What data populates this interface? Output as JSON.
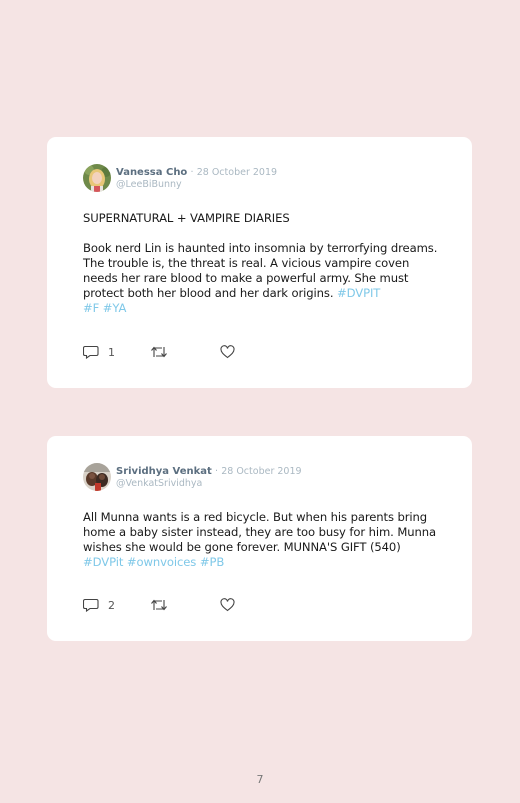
{
  "tweets": [
    {
      "author_name": "Vanessa Cho",
      "separator": "·",
      "date": "28 October 2019",
      "handle": "@LeeBiBunny",
      "title_line": "SUPERNATURAL + VAMPIRE DIARIES",
      "body": "Book nerd Lin is haunted into insomnia by terrorfying dreams. The trouble is, the threat is real. A vicious vampire coven needs her rare blood to make a powerful army. She must protect both her blood and her dark origins.",
      "hashtags": [
        "#DVPIT",
        "#F",
        "#YA"
      ],
      "reply_count": "1",
      "avatar_icon": "user-avatar-blonde",
      "icons": {
        "reply": "reply-icon",
        "retweet": "retweet-icon",
        "like": "heart-icon"
      }
    },
    {
      "author_name": "Srividhya Venkat",
      "separator": "·",
      "date": "28 October 2019",
      "handle": "@VenkatSrividhya",
      "body": "All Munna wants is a red bicycle. But when his parents bring home a baby sister instead, they are too busy for him. Munna wishes she would be gone forever. MUNNA'S GIFT (540)",
      "hashtags": [
        "#DVPit",
        "#ownvoices",
        "#PB"
      ],
      "reply_count": "2",
      "avatar_icon": "user-avatar-dark",
      "icons": {
        "reply": "reply-icon",
        "retweet": "retweet-icon",
        "like": "heart-icon"
      }
    }
  ],
  "page_number": "7",
  "colors": {
    "background": "#f5e4e4",
    "card": "#ffffff",
    "hashtag": "#7fc8e8",
    "name": "#5c6f80",
    "muted": "#aab8c2"
  }
}
